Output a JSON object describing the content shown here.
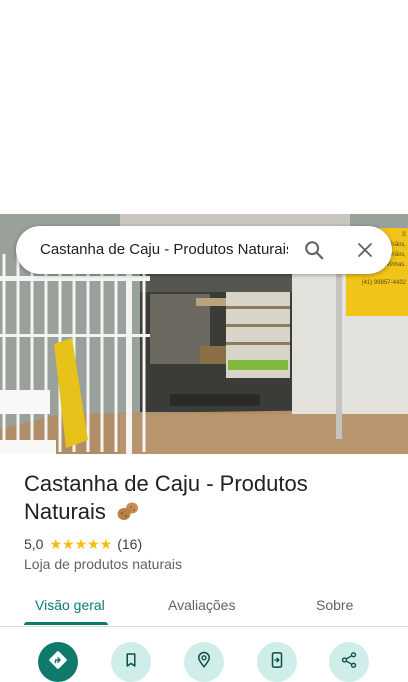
{
  "search": {
    "query": "Castanha de Caju - Produtos Naturais",
    "search_icon": "search-icon",
    "close_icon": "close-icon"
  },
  "photo": {
    "sign_text": [
      "S",
      "Grãos,",
      "Leites, Grãos,",
      "Vinhas.",
      "(41) 99857-4432"
    ]
  },
  "place": {
    "name": "Castanha de Caju - Produtos Naturais",
    "name_icon": "peanut-icon",
    "rating": "5,0",
    "stars": "★★★★★",
    "review_count": "(16)",
    "category": "Loja de produtos naturais"
  },
  "tabs": [
    {
      "label": "Visão geral",
      "active": true
    },
    {
      "label": "Avaliações",
      "active": false
    },
    {
      "label": "Sobre",
      "active": false
    }
  ],
  "actions": [
    {
      "icon": "directions-icon"
    },
    {
      "icon": "bookmark-icon"
    },
    {
      "icon": "nearby-icon"
    },
    {
      "icon": "send-to-phone-icon"
    },
    {
      "icon": "share-icon"
    }
  ],
  "colors": {
    "accent": "#0b7c6f",
    "star": "#fbbc04",
    "action_bg": "#cfeeea"
  }
}
